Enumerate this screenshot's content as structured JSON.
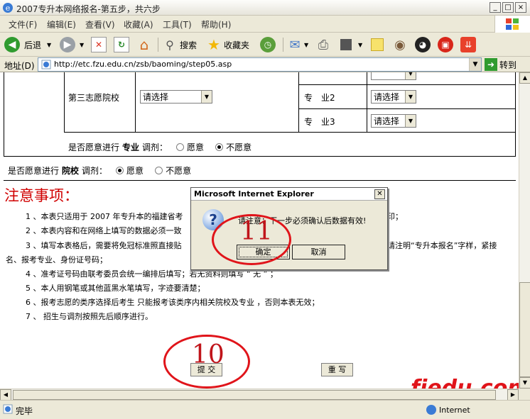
{
  "window": {
    "title": "2007专升本网络报名-第五步，共六步",
    "controls": [
      "_",
      "□",
      "×"
    ]
  },
  "menu": {
    "items": [
      "文件(F)",
      "编辑(E)",
      "查看(V)",
      "收藏(A)",
      "工具(T)",
      "帮助(H)"
    ]
  },
  "toolbar": {
    "back_label": "后退",
    "search_label": "搜索",
    "favorites_label": "收藏夹"
  },
  "address": {
    "label": "地址(D)",
    "url": "http://etc.fzu.edu.cn/zsb/baoming/step05.asp",
    "go_label": "转到"
  },
  "form": {
    "third_choice_label": "第三志愿院校",
    "school_select_value": "请选择",
    "major2_label": "专　业2",
    "major3_label": "专　业3",
    "major_select_value": "请选择",
    "major_adjust": {
      "prefix": "是否愿意进行",
      "bold": "专业",
      "suffix": "调剂：",
      "option_yes": "愿意",
      "option_no": "不愿意",
      "selected": "不愿意"
    },
    "school_adjust": {
      "prefix": "是否愿意进行",
      "bold": "院校",
      "suffix": "调剂：",
      "option_yes": "愿意",
      "option_no": "不愿意",
      "selected": "愿意"
    }
  },
  "notes": {
    "heading": "注意事项：",
    "items": [
      "1 、本表只适用于 2007 年专升本的福建省考",
      "2 、本表内容和在网络上填写的数据必须一致",
      "3 、填写本表格后，需要将免冠标准照直接贴",
      "名、报考专业、身份证号码；",
      "4 、准考证号码由联考委员会统一编排后填写；若无资料则填写 “ 无 ” ；",
      "5 、本人用钢笔或其他蓝黑水笔填写，字迹要清楚；",
      "6 、报考志愿的类序选择后考生 只能报考该类序内相关院校及专业 ，否则本表无效；",
      "7 、  招生与调剂按照先后顺序进行。"
    ],
    "item1_tail": "印；",
    "item3_tail": "请注明“专升本报名”字样，紧接"
  },
  "page_buttons": {
    "submit": "提 交",
    "reset": "重 写"
  },
  "dialog": {
    "title": "Microsoft Internet Explorer",
    "message": "请注意：下一步必须确认后数据有效!",
    "ok_label": "确定",
    "cancel_label": "取消"
  },
  "annotations": {
    "step_submit": "10",
    "step_ok": "11"
  },
  "status": {
    "text": "完毕",
    "zone": "Internet"
  },
  "watermark": "fjedu.com"
}
